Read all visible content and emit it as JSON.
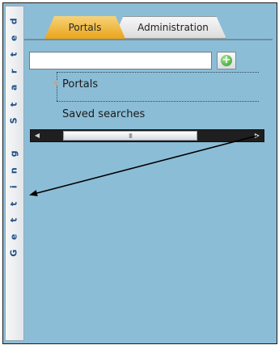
{
  "sidebar": {
    "getting_started_letters": [
      "d",
      "e",
      "t",
      "r",
      "a",
      "t",
      "S",
      " ",
      "g",
      "n",
      "i",
      "t",
      "t",
      "e",
      "G"
    ]
  },
  "tabs": [
    {
      "label": "Portals",
      "active": true
    },
    {
      "label": "Administration",
      "active": false
    }
  ],
  "search": {
    "value": "",
    "placeholder": ""
  },
  "add_button": {
    "icon": "plus-circle-icon"
  },
  "tree": {
    "items": [
      {
        "label": "Portals"
      },
      {
        "label": "Saved searches"
      }
    ]
  },
  "scrollbar": {
    "grip": "III"
  },
  "colors": {
    "panel": "#8cbdd6",
    "active_tab": "#f2c052",
    "add_icon": "#3aa33a"
  }
}
